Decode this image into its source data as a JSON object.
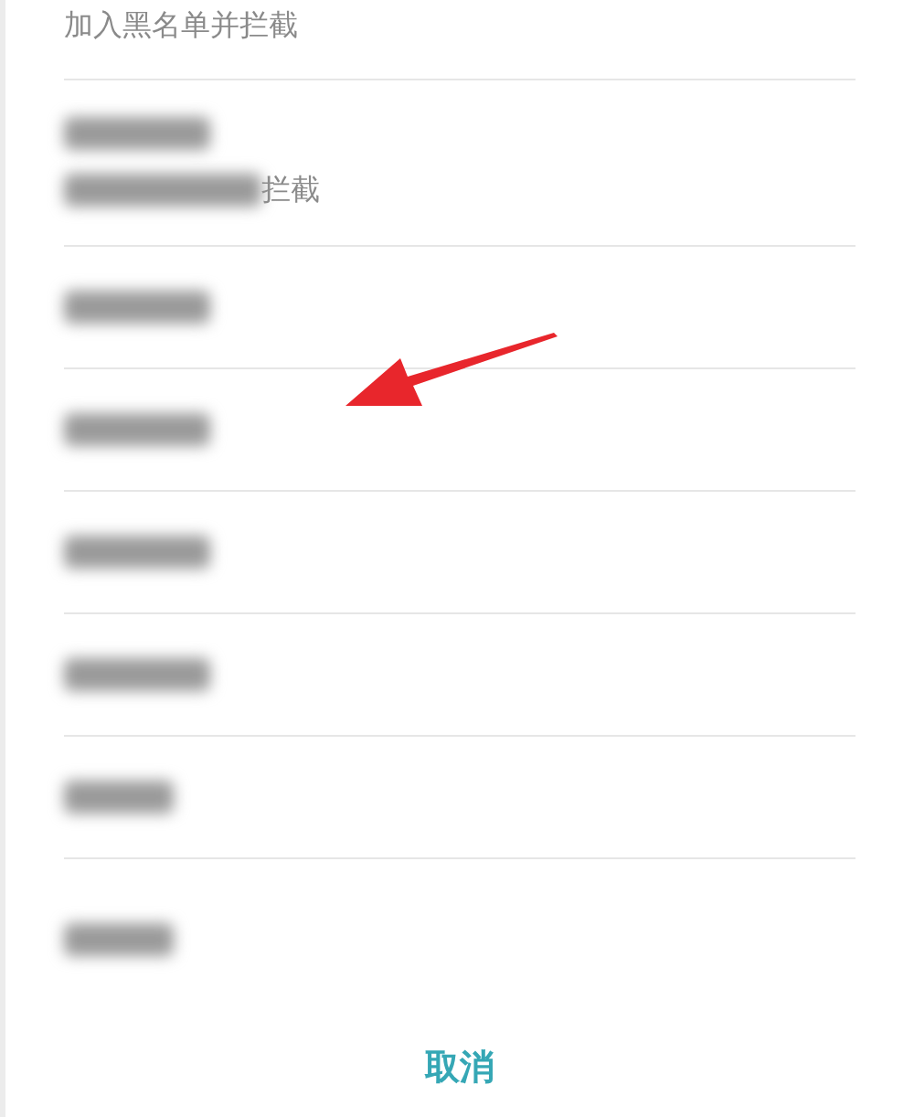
{
  "rows": [
    {
      "title_blurred": false,
      "subtitle": "加入黑名单并拦截",
      "subtitle_blurred": false
    },
    {
      "title_blurred": true,
      "subtitle": "拦截",
      "subtitle_blurred": true
    },
    {
      "title_blurred": true
    },
    {
      "title_blurred": true
    },
    {
      "title_blurred": true
    },
    {
      "title_blurred": true
    },
    {
      "title_blurred": true
    },
    {
      "title_blurred": true
    }
  ],
  "cancel_button": "取消"
}
